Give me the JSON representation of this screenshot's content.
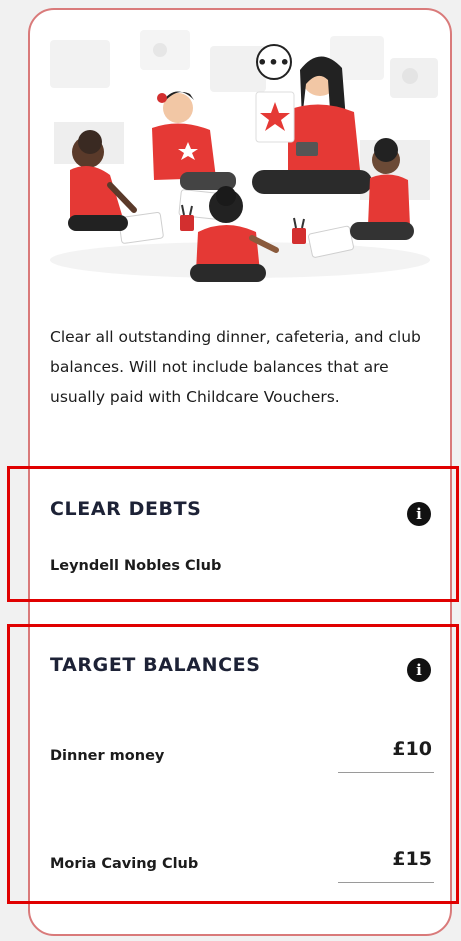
{
  "description": "Clear all outstanding dinner, cafeteria, and club balances. Will not include balances that are usually paid with Childcare Vouchers.",
  "more_button": {
    "label": "•••",
    "icon": "more-options-icon"
  },
  "clear_debts": {
    "title": "CLEAR DEBTS",
    "info_icon": "i",
    "items": [
      {
        "label": "Leyndell Nobles Club"
      }
    ]
  },
  "target_balances": {
    "title": "TARGET BALANCES",
    "info_icon": "i",
    "items": [
      {
        "label": "Dinner money",
        "amount": "£10"
      },
      {
        "label": "Moria Caving Club",
        "amount": "£15"
      }
    ]
  },
  "colors": {
    "accent": "#e53935",
    "highlight": "#e00000",
    "title": "#1d2236",
    "card_border": "#d97a7a"
  }
}
